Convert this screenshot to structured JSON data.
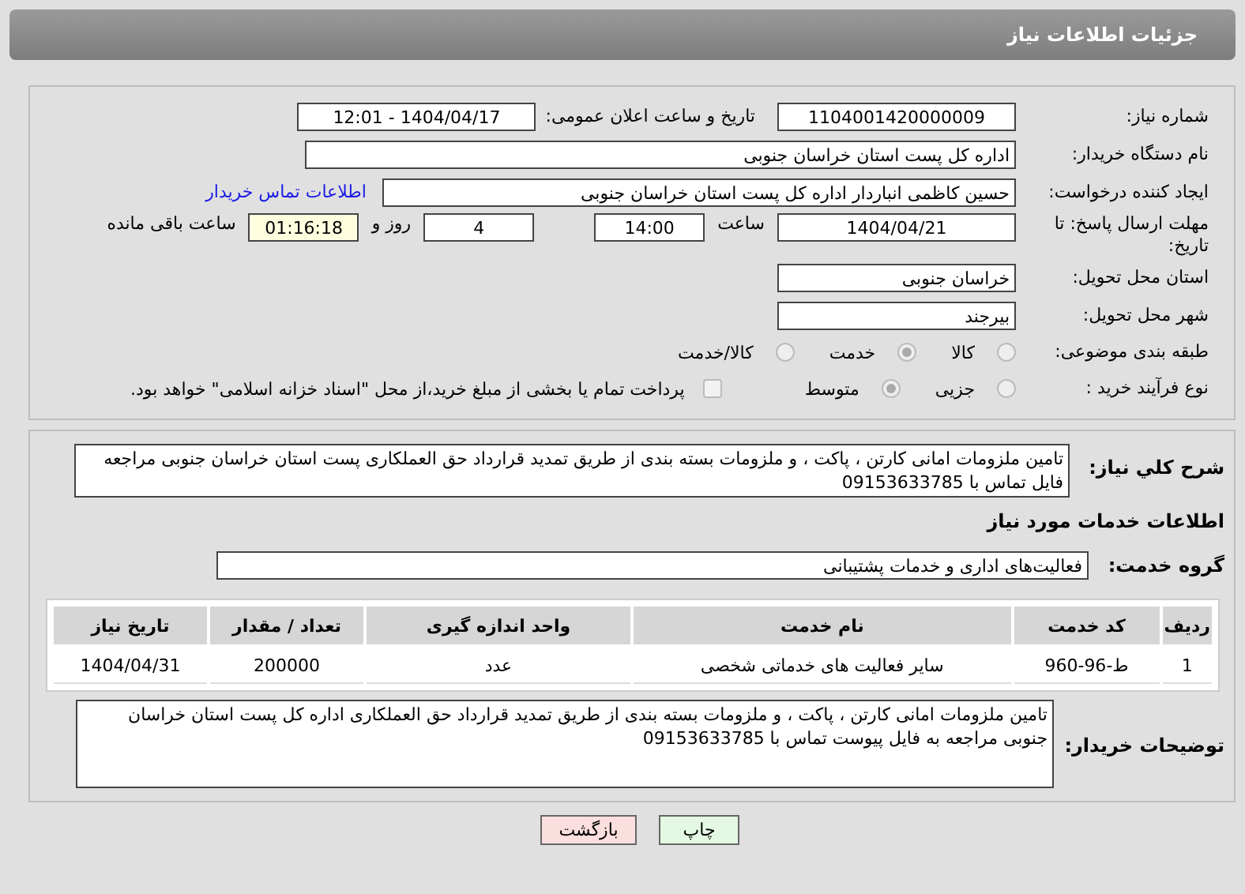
{
  "header": {
    "title": "جزئیات اطلاعات نیاز"
  },
  "details": {
    "need_number": {
      "label": "شماره نیاز:",
      "value": "1104001420000009"
    },
    "announce": {
      "label": "تاریخ و ساعت اعلان عمومی:",
      "value": "1404/04/17 - 12:01"
    },
    "buyer_org": {
      "label": "نام دستگاه خریدار:",
      "value": "اداره کل پست استان خراسان جنوبی"
    },
    "requester": {
      "label": "ایجاد کننده درخواست:",
      "value": "حسین کاظمی انباردار اداره کل پست استان خراسان جنوبی",
      "link": "اطلاعات تماس خریدار"
    },
    "deadline": {
      "label": "مهلت ارسال پاسخ: تا تاریخ:",
      "date": "1404/04/21",
      "time_label": "ساعت",
      "time": "14:00",
      "days": "4",
      "days_label": "روز و",
      "remaining": "01:16:18",
      "remaining_label": "ساعت باقی مانده"
    },
    "province": {
      "label": "استان محل تحویل:",
      "value": "خراسان جنوبی"
    },
    "city": {
      "label": "شهر محل تحویل:",
      "value": "بیرجند"
    },
    "category": {
      "label": "طبقه بندی موضوعی:",
      "options": [
        {
          "label": "کالا",
          "selected": false
        },
        {
          "label": "خدمت",
          "selected": true
        },
        {
          "label": "کالا/خدمت",
          "selected": false
        }
      ]
    },
    "purchase_type": {
      "label": "نوع فرآیند خرید :",
      "options": [
        {
          "label": "جزیی",
          "selected": false
        },
        {
          "label": "متوسط",
          "selected": true
        }
      ],
      "payment": {
        "label": "پرداخت تمام یا بخشی از مبلغ خرید،از محل \"اسناد خزانه اسلامی\" خواهد بود.",
        "checked": false
      }
    }
  },
  "services": {
    "description": {
      "label": "شرح کلي نياز:",
      "value": "تامین ملزومات امانی کارتن ، پاکت ، و ملزومات بسته بندی از طریق تمدید قرارداد حق العملکاری پست استان خراسان جنوبی مراجعه  فایل تماس با 09153633785"
    },
    "heading": "اطلاعات خدمات مورد نیاز",
    "group": {
      "label": "گروه خدمت:",
      "value": "فعالیت‌های اداری و خدمات پشتیبانی"
    },
    "table": {
      "columns": [
        "ردیف",
        "کد خدمت",
        "نام خدمت",
        "واحد اندازه گیری",
        "تعداد / مقدار",
        "تاریخ نیاز"
      ],
      "rows": [
        [
          "1",
          "ط-96-960",
          "سایر فعالیت های خدماتی شخصی",
          "عدد",
          "200000",
          "1404/04/31"
        ]
      ]
    },
    "notes": {
      "label": "توضیحات خریدار:",
      "value": "تامین ملزومات امانی کارتن ، پاکت ، و ملزومات بسته بندی از طریق تمدید  قرارداد حق العملکاری اداره کل پست استان خراسان جنوبی مراجعه به فایل پیوست تماس با 09153633785"
    }
  },
  "buttons": [
    {
      "label": "چاپ",
      "kind": "print"
    },
    {
      "label": "بازگشت",
      "kind": "back"
    }
  ]
}
